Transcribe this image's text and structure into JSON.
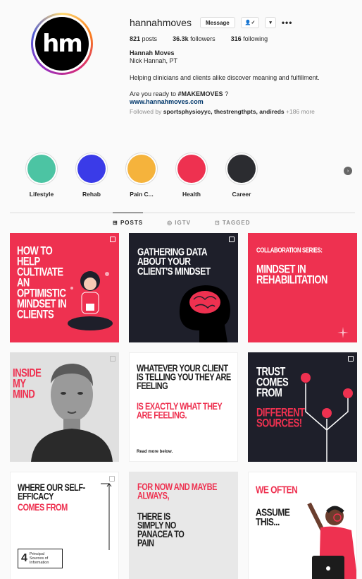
{
  "profile": {
    "avatar_text": "hm",
    "username": "hannahmoves",
    "message_label": "Message",
    "follow_glyph": "👤✓",
    "dropdown_glyph": "▾",
    "more_glyph": "•••",
    "posts_count": "821",
    "posts_label": "posts",
    "followers_count": "36.3k",
    "followers_label": "followers",
    "following_count": "316",
    "following_label": "following",
    "full_name": "Hannah Moves",
    "subtitle": "Nick Hannah, PT",
    "bio_line": "Helping clinicians and clients alike discover meaning and fulfillment.",
    "bio_question_prefix": "Are you ready to ",
    "bio_hashtag": "#MAKEMOVES",
    "bio_question_suffix": " ?",
    "website": "www.hannahmoves.com",
    "followed_prefix": "Followed by ",
    "followed_names": "sportsphysioyyc, thestrengthpts, andireds",
    "followed_suffix": " +186 more"
  },
  "highlights": [
    {
      "label": "Lifestyle",
      "color": "#4cc4a3"
    },
    {
      "label": "Rehab",
      "color": "#3a3be8"
    },
    {
      "label": "Pain C...",
      "color": "#f5b33c"
    },
    {
      "label": "Health",
      "color": "#ee3150"
    },
    {
      "label": "Career",
      "color": "#2b2c30"
    }
  ],
  "tabs": [
    {
      "label": "POSTS",
      "icon": "grid-icon",
      "glyph": "⊞"
    },
    {
      "label": "IGTV",
      "icon": "igtv-icon",
      "glyph": "◎"
    },
    {
      "label": "TAGGED",
      "icon": "tag-icon",
      "glyph": "⊡"
    }
  ],
  "posts": [
    {
      "text": "HOW TO HELP CULTIVATE AN OPTIMISTIC MINDSET IN CLIENTS",
      "bg": "#ee3150",
      "fg": "#ffffff"
    },
    {
      "text": "GATHERING DATA ABOUT YOUR CLIENT'S MINDSET",
      "bg": "#1e1f2a",
      "fg": "#ffffff"
    },
    {
      "text": "COLLABORATION SERIES:",
      "text2": "MINDSET IN REHABILITATION",
      "bg": "#ee3150",
      "fg": "#ffffff"
    },
    {
      "text": "INSIDE MY MIND",
      "bg": "#e6e6e6",
      "fg": "#ee3150"
    },
    {
      "text": "WHATEVER YOUR CLIENT IS TELLING YOU THEY ARE FEELING",
      "text2": "IS EXACTLY WHAT THEY ARE FEELING.",
      "text3": "Read more below.",
      "bg": "#ffffff",
      "fg": "#1c1c1c"
    },
    {
      "text": "TRUST COMES FROM",
      "text2": "DIFFERENT SOURCES!",
      "bg": "#1e1f2a",
      "fg": "#ffffff"
    },
    {
      "text": "WHERE OUR SELF-EFFICACY",
      "text2": "COMES FROM",
      "text3": "Principal Sources of Information",
      "text4": "4",
      "bg": "#ffffff",
      "fg": "#1c1c1c"
    },
    {
      "text": "FOR NOW AND MAYBE ALWAYS,",
      "text2": "THERE IS SIMPLY NO PANACEA TO PAIN",
      "bg": "#e8e8e8",
      "fg": "#1c1c1c"
    },
    {
      "text": "WE OFTEN",
      "text2": "ASSUME THIS...",
      "bg": "#ffffff",
      "fg": "#1c1c1c"
    }
  ]
}
